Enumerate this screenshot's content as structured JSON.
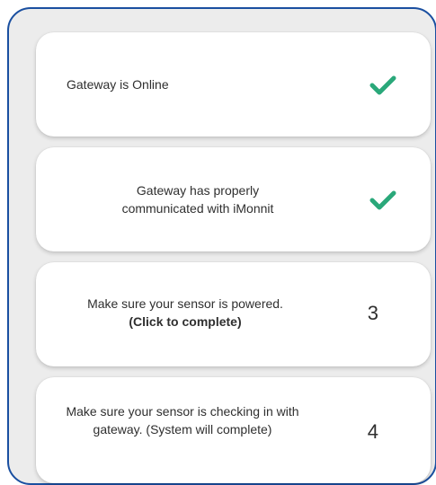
{
  "steps": [
    {
      "text": "Gateway is Online",
      "status": "complete",
      "icon": "checkmark-icon"
    },
    {
      "text": "Gateway has properly communicated with iMonnit",
      "status": "complete",
      "icon": "checkmark-icon"
    },
    {
      "text": "Make sure your sensor is powered.",
      "action": "(Click to complete)",
      "number": "3"
    },
    {
      "text": "Make sure your sensor is checking in with gateway. (System will complete)",
      "number": "4"
    }
  ],
  "colors": {
    "frame_border": "#1a4fa0",
    "check": "#2aa87a",
    "card_bg": "#ffffff",
    "panel_bg": "#ececec"
  }
}
